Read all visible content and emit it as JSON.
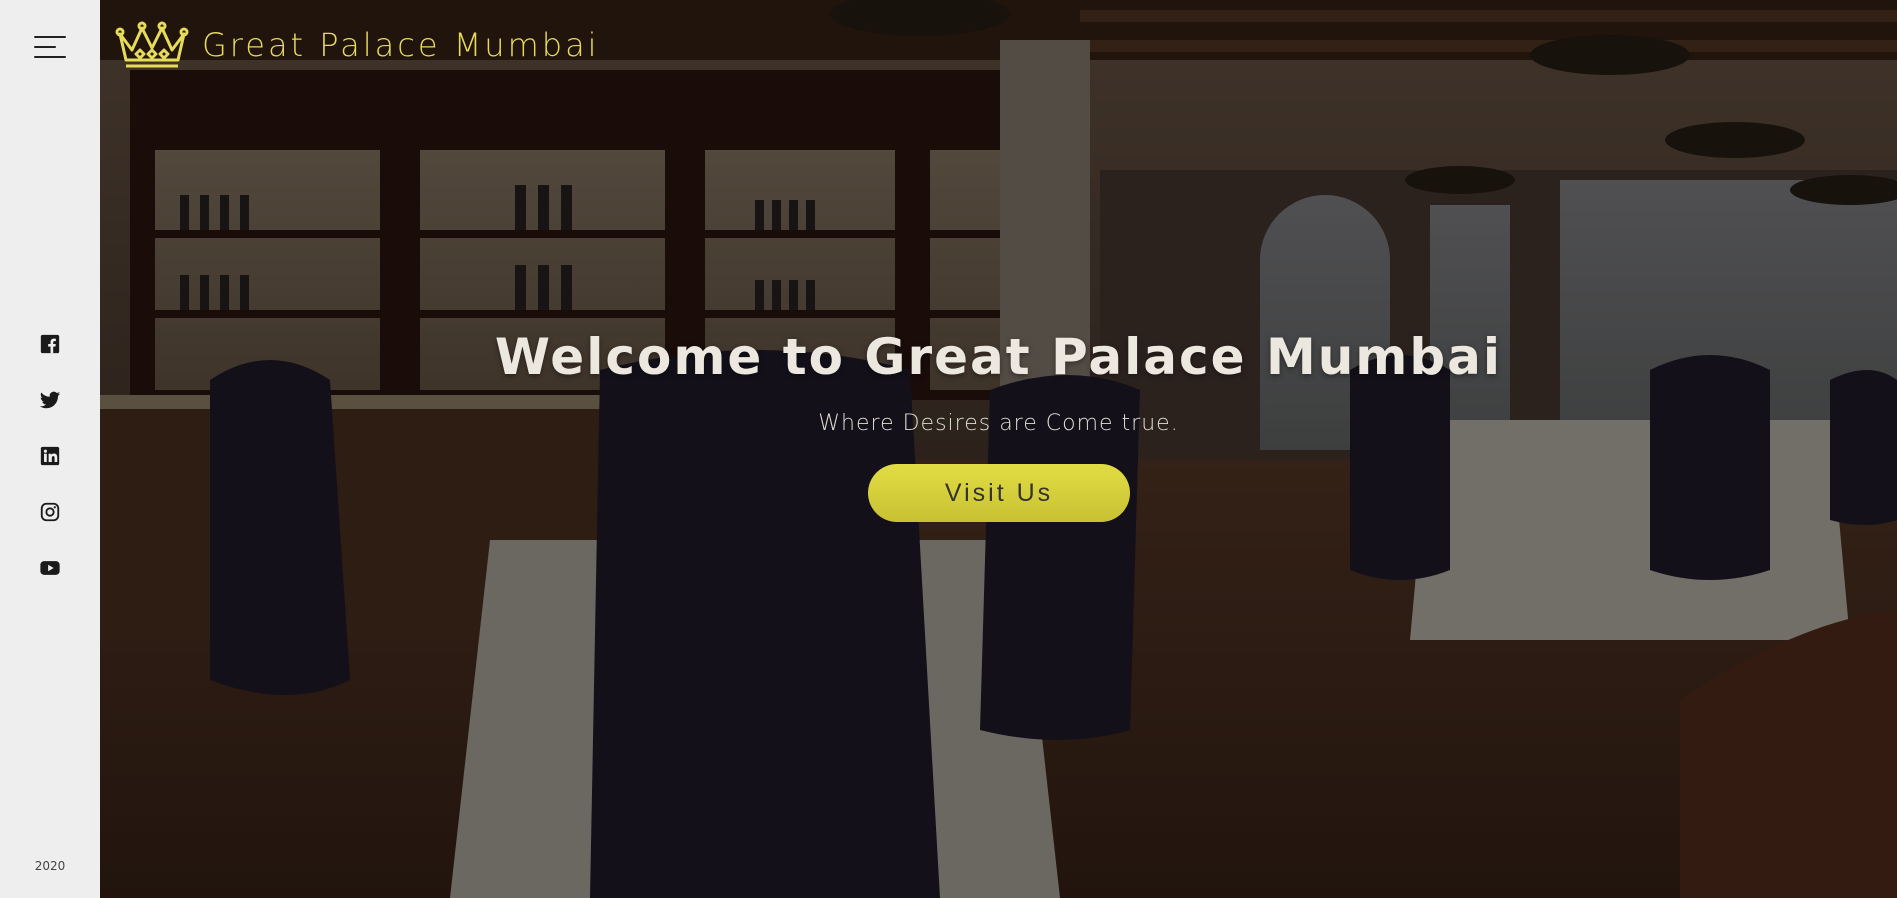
{
  "brand": {
    "name": "Great Palace Mumbai",
    "accent_color": "#e6dc5a"
  },
  "sidebar": {
    "menu_icon": "hamburger-menu-icon",
    "social": [
      {
        "name": "facebook",
        "icon": "facebook-icon"
      },
      {
        "name": "twitter",
        "icon": "twitter-icon"
      },
      {
        "name": "linkedin",
        "icon": "linkedin-icon"
      },
      {
        "name": "instagram",
        "icon": "instagram-icon"
      },
      {
        "name": "youtube",
        "icon": "youtube-icon"
      }
    ],
    "year": "2020"
  },
  "hero": {
    "headline": "Welcome to Great Palace Mumbai",
    "tagline": "Where Desires are Come true.",
    "cta_label": "Visit Us",
    "cta_color": "#d8d23c"
  }
}
